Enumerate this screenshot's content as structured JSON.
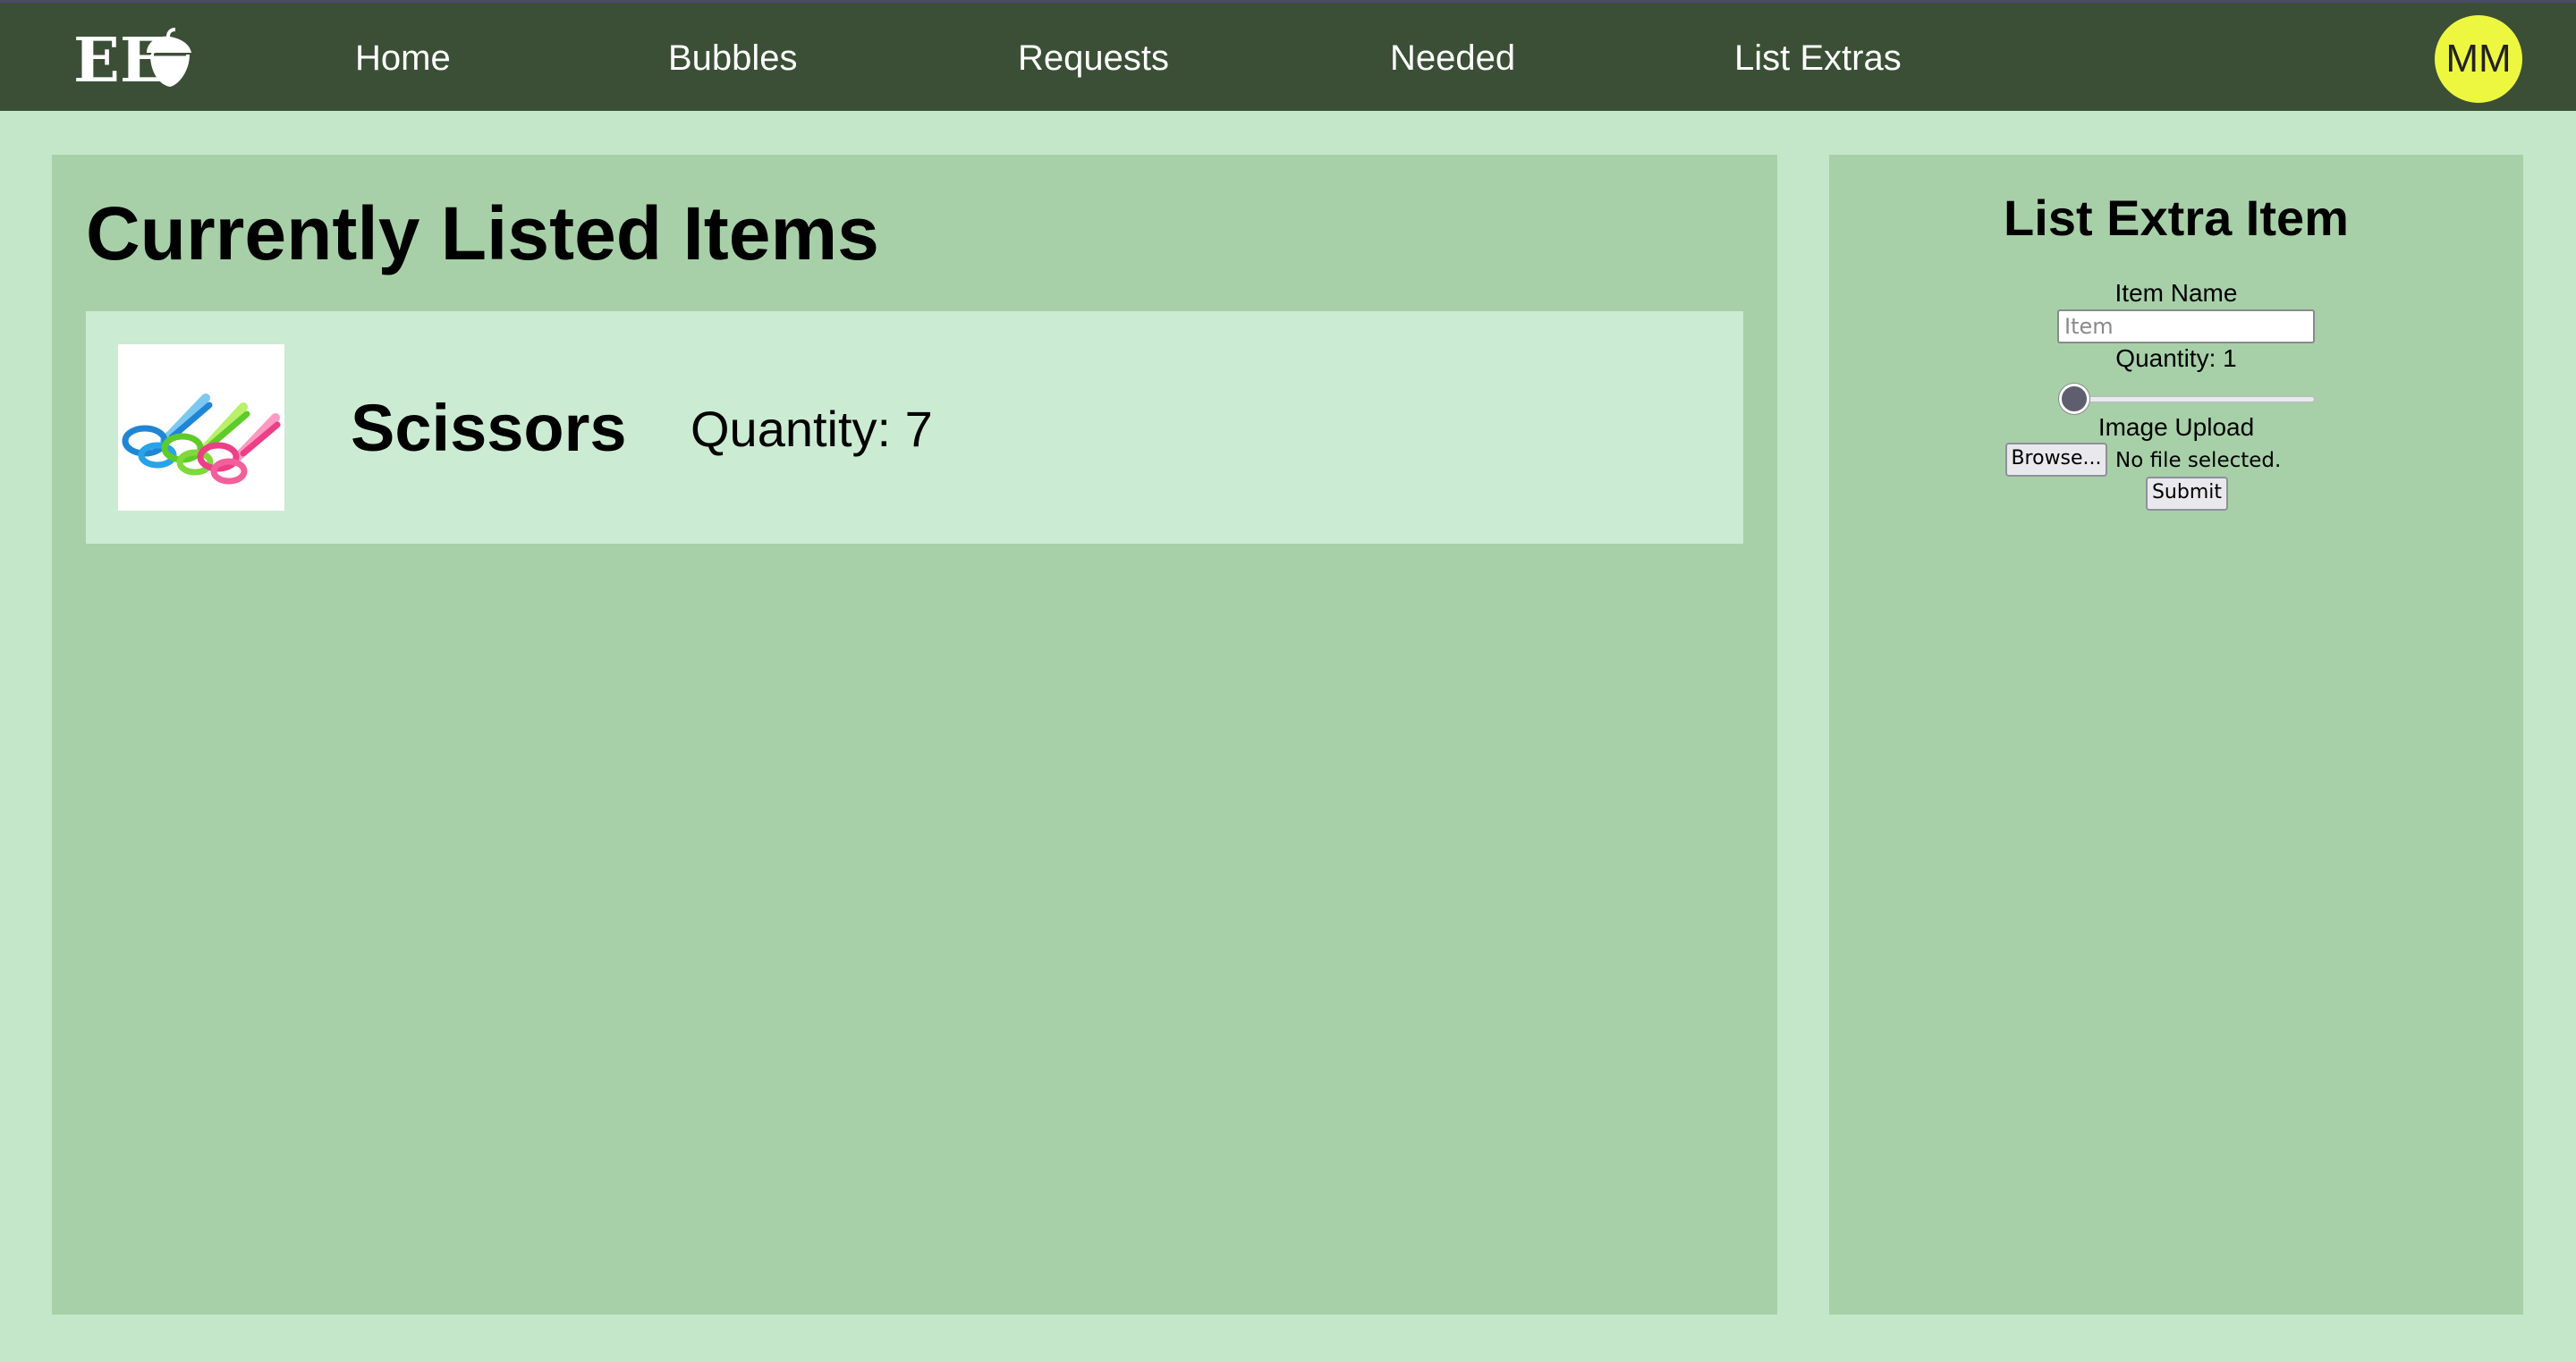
{
  "nav": {
    "logo_text": "EE",
    "links": [
      "Home",
      "Bubbles",
      "Requests",
      "Needed",
      "List Extras"
    ],
    "avatar_initials": "MM"
  },
  "listed": {
    "title": "Currently Listed Items",
    "items": [
      {
        "name": "Scissors",
        "quantity_label": "Quantity: 7",
        "image_icon": "scissors-image"
      }
    ]
  },
  "form": {
    "title": "List Extra Item",
    "item_name_label": "Item Name",
    "item_name_placeholder": "Item",
    "item_name_value": "",
    "quantity_label": "Quantity: 1",
    "quantity_value": 1,
    "image_upload_label": "Image Upload",
    "browse_label": "Browse...",
    "file_status": "No file selected.",
    "submit_label": "Submit"
  },
  "colors": {
    "navbar": "#3b4f36",
    "page_background": "#c3e7c8",
    "panel": "#a7d0a8",
    "card": "#ccebd3",
    "avatar": "#eef73f"
  }
}
